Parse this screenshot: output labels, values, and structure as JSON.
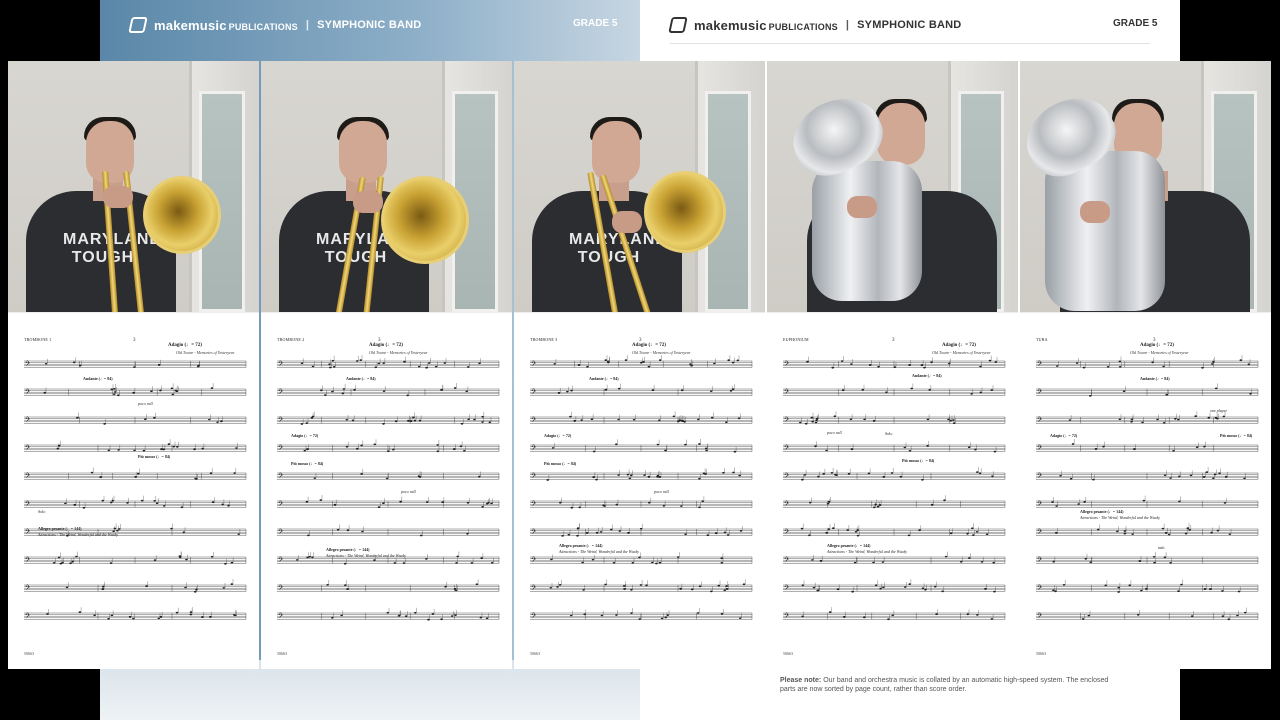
{
  "header": {
    "brand": "makemusic",
    "brand_suffix": "PUBLICATIONS",
    "separator": "|",
    "category": "SYMPHONIC BAND",
    "grade": "GRADE 5"
  },
  "note": {
    "bold": "Please note:",
    "text": "Our band and orchestra music is collated by an automatic high-speed system. The enclosed parts are now sorted by page count, rather than score order."
  },
  "panels": [
    {
      "instrument": "TROMBONE 1",
      "page_number": "3",
      "tempo": "Adagio (♩= 72)",
      "subtitle": "Old Towne - Memories of Yesteryear",
      "shirt_text": "MARYLAND TOUGH",
      "footer": "50663"
    },
    {
      "instrument": "TROMBONE 2",
      "page_number": "3",
      "tempo": "Adagio (♩= 72)",
      "subtitle": "Old Towne - Memories of Yesteryear",
      "shirt_text": "MARYLAND TOUGH",
      "footer": "50663"
    },
    {
      "instrument": "TROMBONE 3",
      "page_number": "3",
      "tempo": "Adagio (♩= 72)",
      "subtitle": "Old Towne - Memories of Yesteryear",
      "shirt_text": "MARYLAND TOUGH",
      "footer": "50663"
    },
    {
      "instrument": "EUPHONIUM",
      "page_number": "3",
      "tempo": "Adagio (♩= 72)",
      "subtitle": "Old Towne - Memories of Yesteryear",
      "shirt_text": "",
      "footer": "50663"
    },
    {
      "instrument": "TUBA",
      "page_number": "3",
      "tempo": "Adagio (♩= 72)",
      "subtitle": "Old Towne - Memories of Yesteryear",
      "shirt_text": "",
      "footer": "50663"
    }
  ],
  "score_marks": {
    "andante": "Andante (♩= 84)",
    "piu_mosso": "Più mosso (♩= 84)",
    "allegro": "Allegro pesante (♩= 144)",
    "attractions": "Attractions - The Weird, Wonderful and the Wacky",
    "poco_rall": "poco rall.",
    "rall": "rall.",
    "solo": "Solo",
    "tutti": "tutti",
    "one_player": "one player"
  }
}
